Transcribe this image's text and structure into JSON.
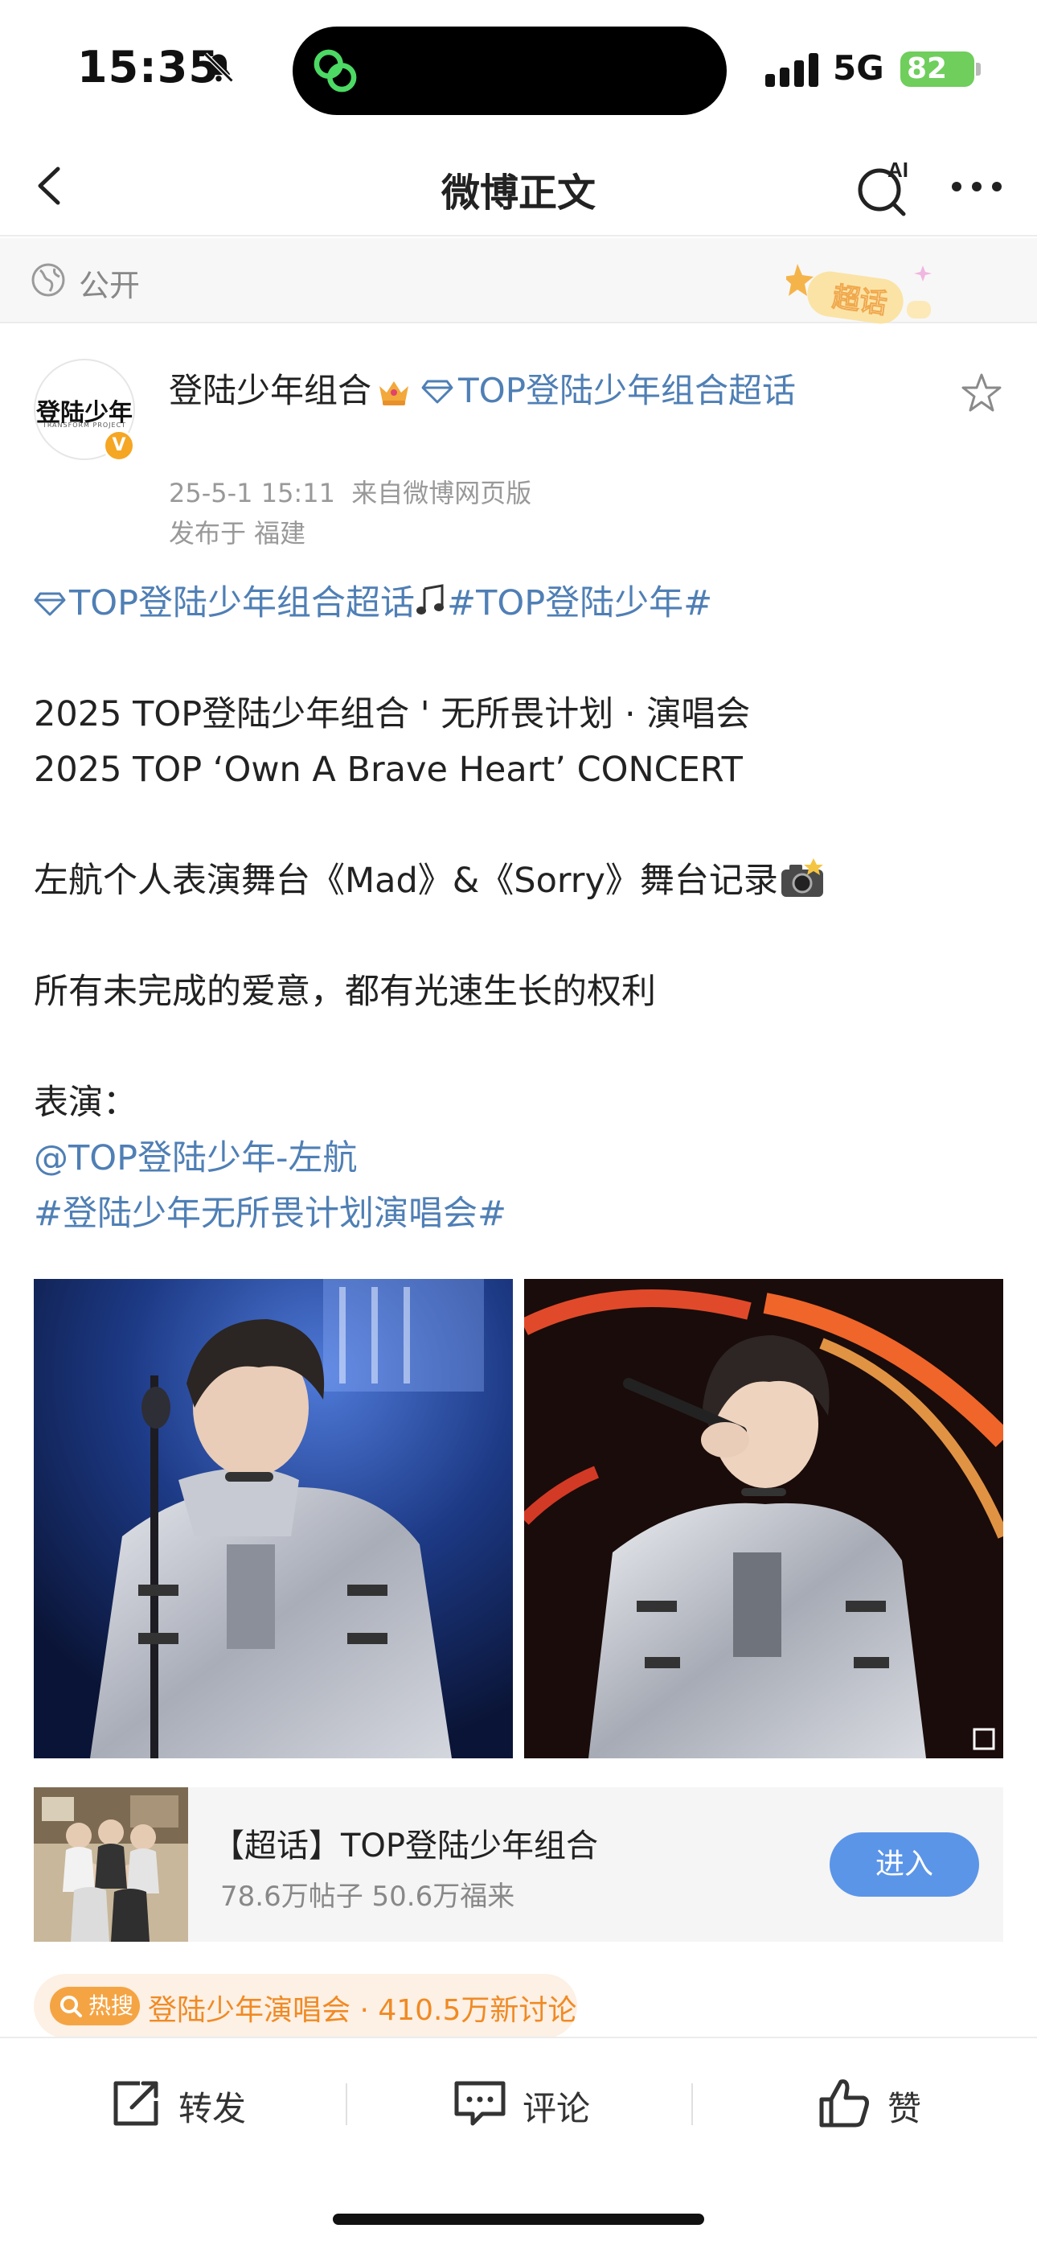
{
  "status_bar": {
    "time": "15:35",
    "network": "5G",
    "battery": "82"
  },
  "nav": {
    "title": "微博正文",
    "ai_label": "AI"
  },
  "visibility": {
    "label": "公开",
    "supertopic_badge": "超话"
  },
  "author": {
    "name": "登陆少年组合",
    "topic": "TOP登陆少年组合超话",
    "avatar_text": "登陆少年",
    "avatar_subtext": "TRANSFORM PROJECT",
    "verified_mark": "V",
    "timestamp": "25-5-1 15:11",
    "source": "来自微博网页版",
    "location": "发布于 福建"
  },
  "post": {
    "line1_topic": "TOP登陆少年组合超话",
    "line1_hashtag": "#TOP登陆少年#",
    "line2": "2025 TOP登陆少年组合 ' 无所畏计划 · 演唱会",
    "line3": "2025 TOP ‘Own A Brave Heart’ CONCERT",
    "line4": "左航个人表演舞台《Mad》&《Sorry》舞台记录",
    "line5": "所有未完成的爱意，都有光速生长的权利",
    "line6": "表演：",
    "mention": "@TOP登陆少年-左航",
    "hashtag2": "#登陆少年无所畏计划演唱会#"
  },
  "topic_card": {
    "title": "【超话】TOP登陆少年组合",
    "stats": "78.6万帖子 50.6万福来",
    "enter_label": "进入"
  },
  "hot_search": {
    "tag": "热搜",
    "text": "登陆少年演唱会 · 410.5万新讨论"
  },
  "actions": {
    "repost": "转发",
    "comment": "评论",
    "like": "赞"
  },
  "colors": {
    "link": "#4f7fb5",
    "enter_button": "#5b95e8",
    "hot": "#f08a24",
    "battery": "#6fce5c"
  }
}
